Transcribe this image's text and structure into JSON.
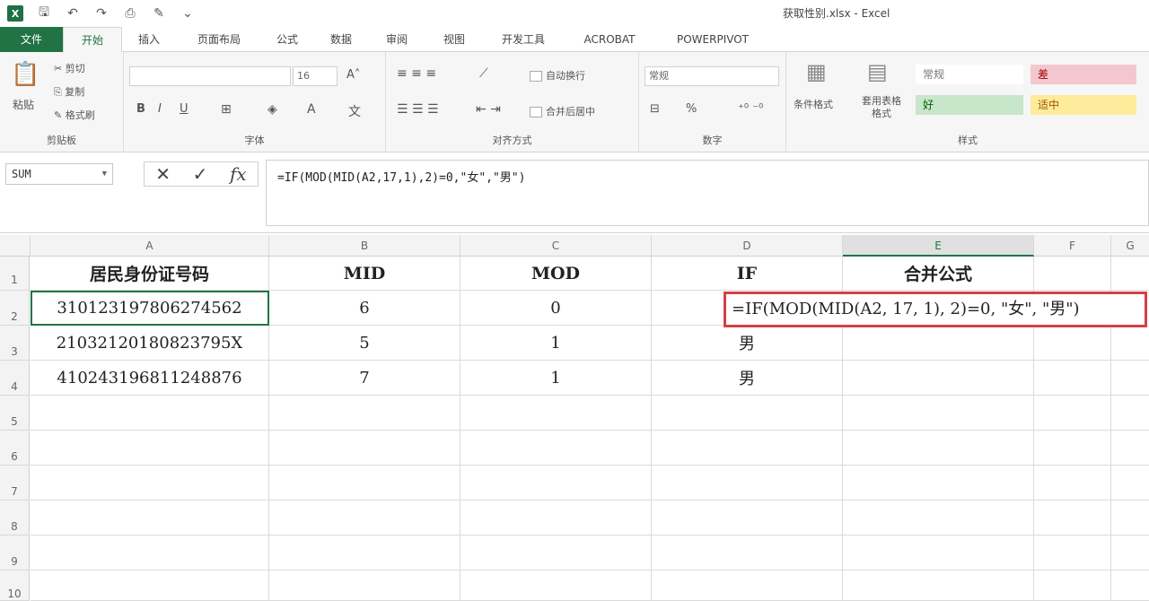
{
  "window": {
    "title": "获取性别.xlsx - Excel",
    "logo_letter": "X"
  },
  "tabs": [
    "文件",
    "开始",
    "插入",
    "页面布局",
    "公式",
    "数据",
    "审阅",
    "视图",
    "开发工具",
    "ACROBAT",
    "POWERPIVOT"
  ],
  "ribbon": {
    "clipboard": {
      "paste": "粘贴",
      "cut": "剪切",
      "copy": "复制",
      "format_painter": "格式刷",
      "label": "剪贴板"
    },
    "font": {
      "size": "16",
      "bold": "B",
      "italic": "I",
      "underline": "U",
      "label": "字体"
    },
    "align": {
      "wrap": "自动换行",
      "merge": "合并后居中",
      "label": "对齐方式"
    },
    "number": {
      "format": "常规",
      "percent": "%",
      "label": "数字"
    },
    "styles": {
      "conditional": "条件格式",
      "table": "套用表格格式",
      "normal": "常规",
      "bad": "差",
      "good": "好",
      "neutral": "适中",
      "label": "样式"
    }
  },
  "formula_bar": {
    "name_box": "SUM",
    "cancel": "✕",
    "enter": "✓",
    "fx": "fx",
    "formula": "=IF(MOD(MID(A2,17,1),2)=0,\"女\",\"男\")"
  },
  "columns": [
    "A",
    "B",
    "C",
    "D",
    "E",
    "F",
    "G"
  ],
  "rows": [
    "1",
    "2",
    "3",
    "4",
    "5",
    "6",
    "7",
    "8",
    "9",
    "10"
  ],
  "table": {
    "headers": [
      "居民身份证号码",
      "MID",
      "MOD",
      "IF",
      "合并公式"
    ],
    "data": [
      [
        "310123197806274562",
        "6",
        "0",
        "",
        ""
      ],
      [
        "21032120180823795X",
        "5",
        "1",
        "男",
        ""
      ],
      [
        "410243196811248876",
        "7",
        "1",
        "男",
        ""
      ]
    ],
    "editing_formula": "=IF(MOD(MID(A2, 17, 1), 2)=0, \"女\", \"男\")"
  },
  "colors": {
    "accent": "#217346",
    "highlight_border": "#d64045"
  }
}
